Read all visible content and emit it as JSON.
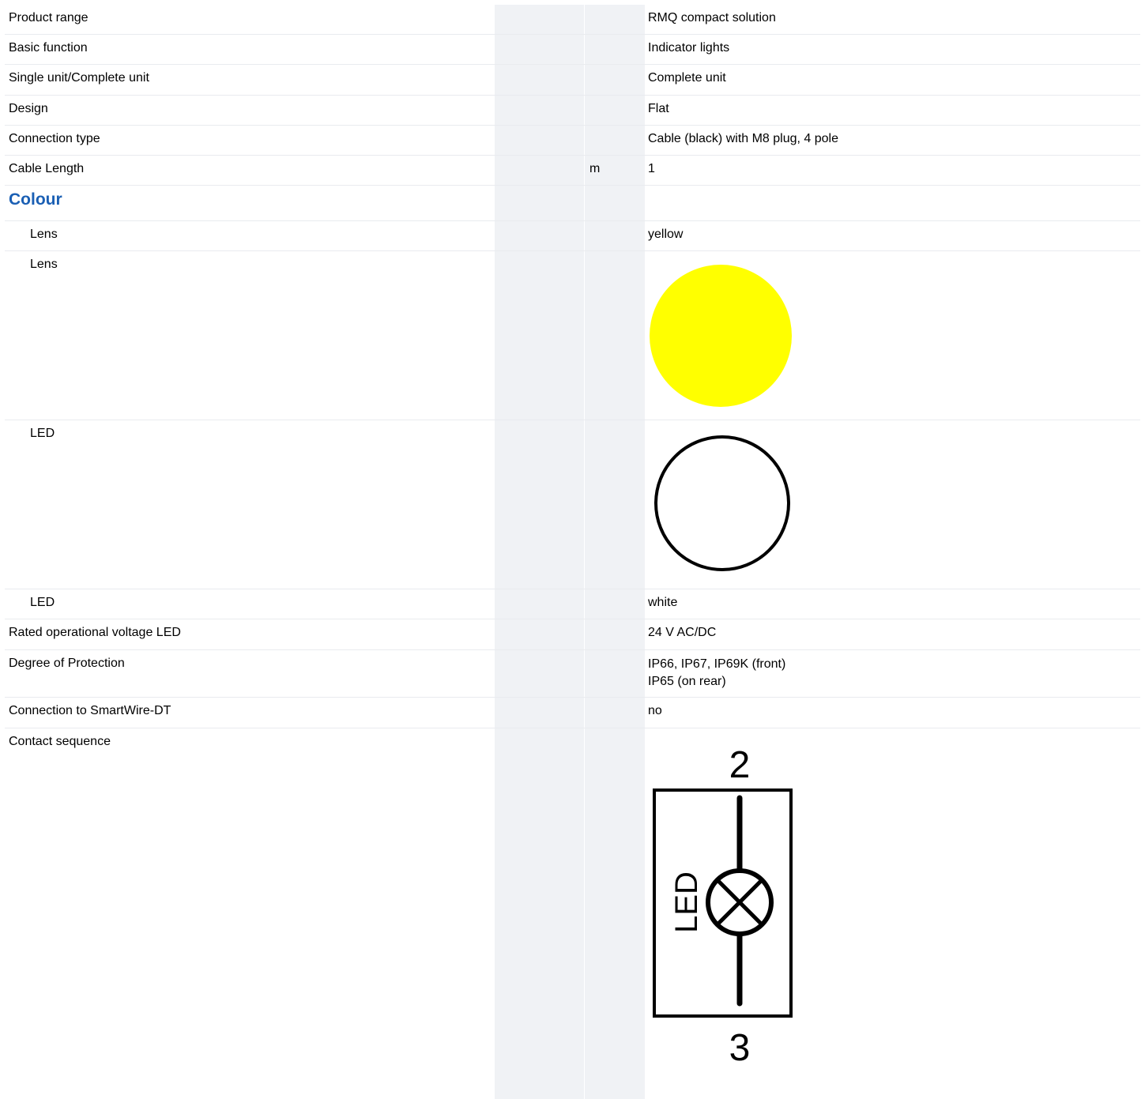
{
  "rows": [
    {
      "label": "Product range",
      "unit": "",
      "value": "RMQ compact solution"
    },
    {
      "label": "Basic function",
      "unit": "",
      "value": "Indicator lights"
    },
    {
      "label": "Single unit/Complete unit",
      "unit": "",
      "value": "Complete unit"
    },
    {
      "label": "Design",
      "unit": "",
      "value": "Flat"
    },
    {
      "label": "Connection type",
      "unit": "",
      "value": "Cable (black) with M8 plug, 4 pole"
    },
    {
      "label": "Cable Length",
      "unit": "m",
      "value": "1"
    },
    {
      "heading": "Colour"
    },
    {
      "label": "Lens",
      "unit": "",
      "value": "yellow"
    },
    {
      "label": "Lens",
      "swatch_color": "#ffff00"
    },
    {
      "label": "LED",
      "swatch_color": "#ffffff"
    },
    {
      "label": "LED",
      "unit": "",
      "value": "white"
    },
    {
      "label": "Rated operational voltage LED",
      "unit": "",
      "value": "24 V AC/DC"
    },
    {
      "label": "Degree of Protection",
      "unit": "",
      "value": "IP66, IP67, IP69K (front)\nIP65 (on rear)"
    },
    {
      "label": "Connection to SmartWire-DT",
      "unit": "",
      "value": "no"
    },
    {
      "label": "Contact sequence",
      "diagram": {
        "top_terminal": "2",
        "bottom_terminal": "3",
        "element_label": "LED"
      }
    }
  ],
  "colors": {
    "heading": "#1a5fb4",
    "column_shade": "#f0f2f5",
    "lens_yellow": "#ffff00"
  }
}
